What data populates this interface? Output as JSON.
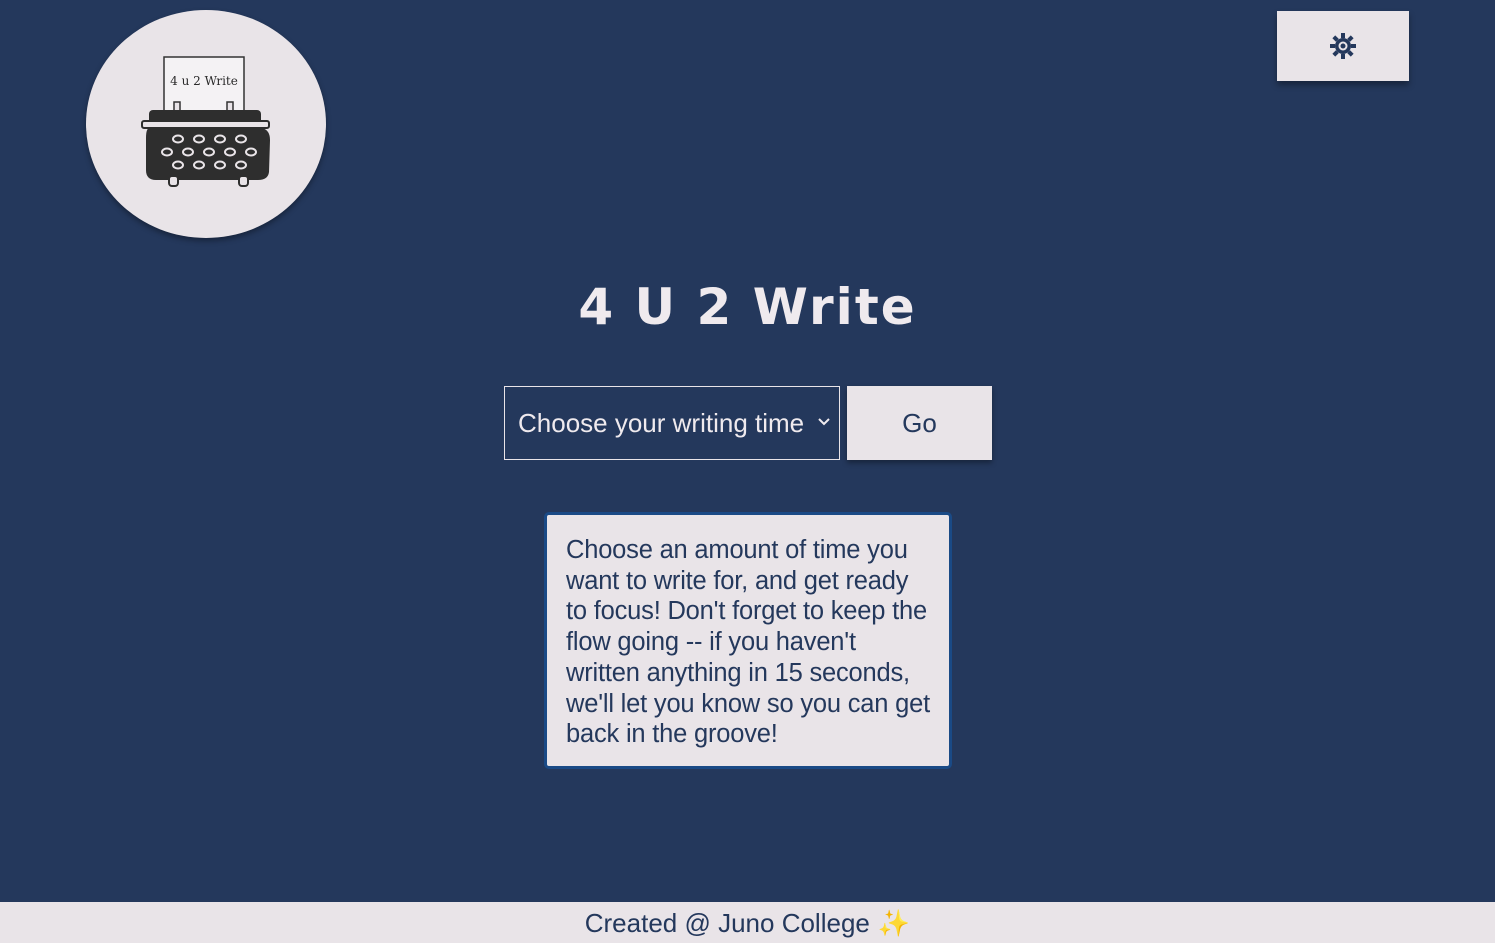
{
  "header": {
    "logo_text": "4 u 2 Write",
    "logo_icon": "typewriter-icon",
    "theme_toggle_icon": "sun-icon"
  },
  "main": {
    "title": "4 U 2 Write",
    "time_select": {
      "selected": "Choose your writing time",
      "icon": "chevron-down-icon"
    },
    "go_label": "Go",
    "instructions": "Choose an amount of time you want to write for, and get ready to focus! Don't forget to keep the flow going -- if you haven't written anything in 15 seconds, we'll let you know so you can get back in the groove!"
  },
  "footer": {
    "text": "Created @ Juno College",
    "emoji": "✨"
  },
  "colors": {
    "background": "#24385c",
    "surface": "#e9e4e8",
    "accent_border": "#1a4a86"
  }
}
